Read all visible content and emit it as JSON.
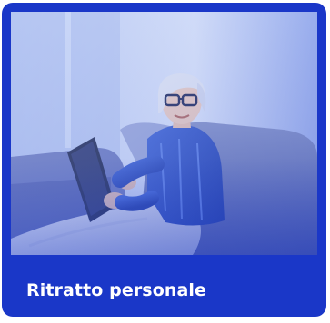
{
  "card": {
    "title": "Ritratto personale",
    "background_color": "#1a37c8",
    "image_description_icon": "photo-woman-with-tablet-on-sofa"
  }
}
